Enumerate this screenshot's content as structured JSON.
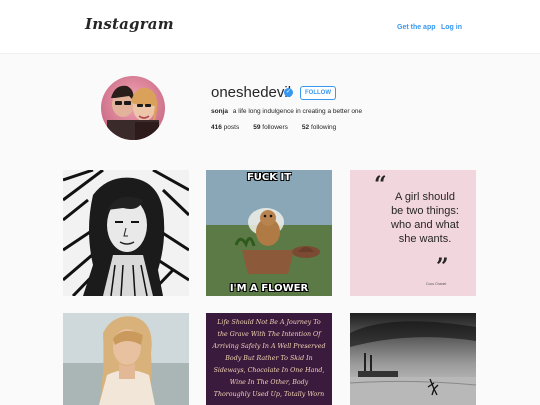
{
  "header": {
    "logo": "Instagram",
    "get_app": "Get the app",
    "login": "Log in"
  },
  "profile": {
    "username": "oneshedevil",
    "verified_icon": "check-icon",
    "follow_label": "FOLLOW",
    "full_name": "sonja",
    "bio": "a life long indulgence in creating a better one",
    "posts_count": "416",
    "posts_label": "posts",
    "followers_count": "59",
    "followers_label": "followers",
    "following_count": "52",
    "following_label": "following"
  },
  "posts": {
    "meme": {
      "top": "FUCK IT",
      "bottom": "I'M A FLOWER"
    },
    "quote": {
      "open": "“",
      "close": "”",
      "text": "A girl should be two things: who and what she wants.",
      "author": "Coco Chanel"
    },
    "journey": {
      "text": "Life Should Not Be A Journey To the Grave With The Intention Of Arriving Safely In A Well Preserved Body But Rather To Skid In Sideways, Chocolate In One Hand, Wine In The Other, Body Thoroughly Used Up, Totally Worn"
    }
  },
  "colors": {
    "accent": "#3897f0",
    "background": "#fafafa"
  }
}
